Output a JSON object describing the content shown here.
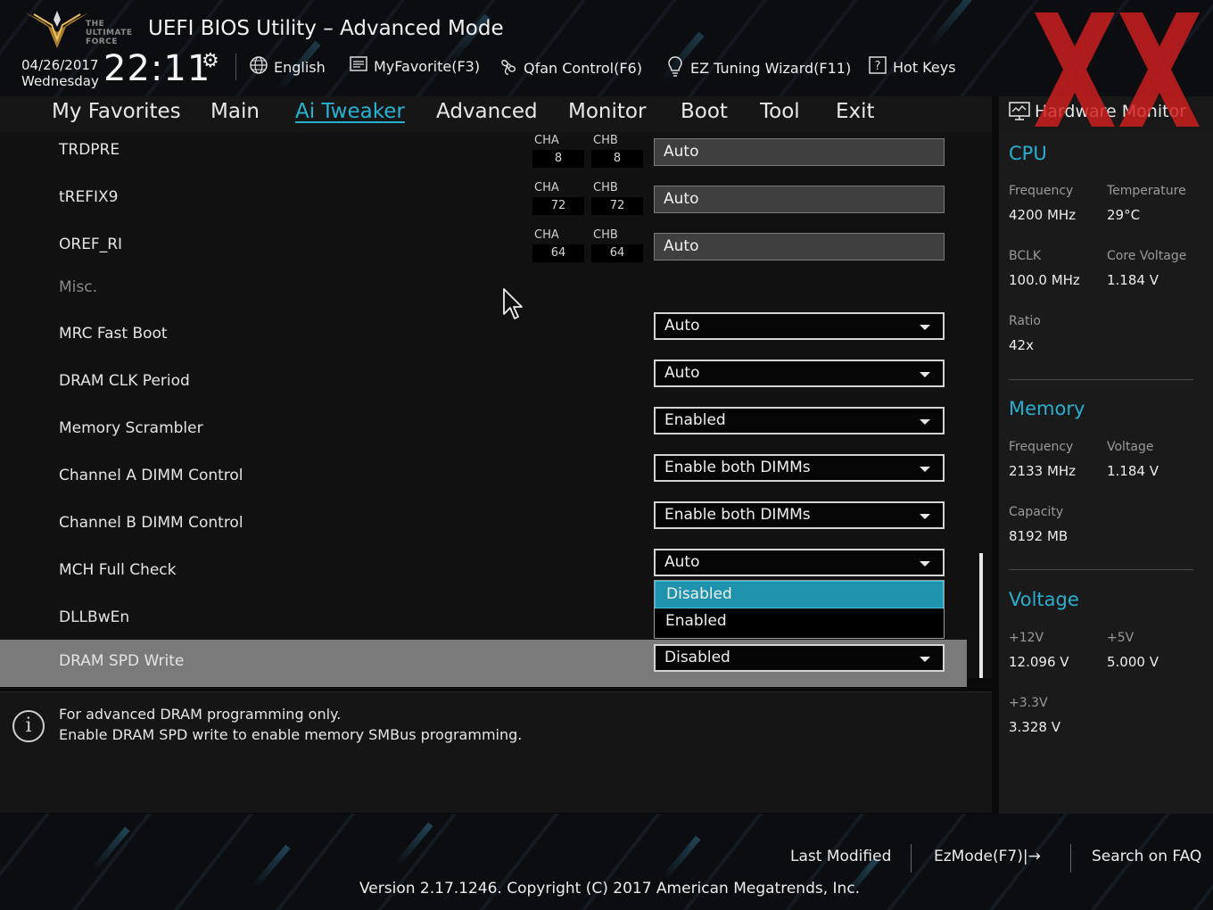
{
  "header": {
    "logo_lines": [
      "THE",
      "ULTIMATE",
      "FORCE"
    ],
    "title": "UEFI BIOS Utility – Advanced Mode",
    "date": "04/26/2017",
    "weekday": "Wednesday",
    "time": "22:11",
    "tools": [
      {
        "label": "English",
        "icon": "globe-icon"
      },
      {
        "label": "MyFavorite(F3)",
        "icon": "favorite-list-icon"
      },
      {
        "label": "Qfan Control(F6)",
        "icon": "fan-icon"
      },
      {
        "label": "EZ Tuning Wizard(F11)",
        "icon": "lightbulb-icon"
      },
      {
        "label": "Hot Keys",
        "icon": "help-box-icon"
      }
    ]
  },
  "nav": {
    "tabs": [
      {
        "label": "My Favorites",
        "active": false
      },
      {
        "label": "Main",
        "active": false
      },
      {
        "label": "Ai Tweaker",
        "active": true
      },
      {
        "label": "Advanced",
        "active": false
      },
      {
        "label": "Monitor",
        "active": false
      },
      {
        "label": "Boot",
        "active": false
      },
      {
        "label": "Tool",
        "active": false
      },
      {
        "label": "Exit",
        "active": false
      }
    ]
  },
  "settings": {
    "channel_rows": [
      {
        "label": "TRDPRE",
        "cha_label": "CHA",
        "cha": "8",
        "chb_label": "CHB",
        "chb": "8",
        "value": "Auto"
      },
      {
        "label": "tREFIX9",
        "cha_label": "CHA",
        "cha": "72",
        "chb_label": "CHB",
        "chb": "72",
        "value": "Auto"
      },
      {
        "label": "OREF_RI",
        "cha_label": "CHA",
        "cha": "64",
        "chb_label": "CHB",
        "chb": "64",
        "value": "Auto"
      }
    ],
    "misc_label": "Misc.",
    "select_rows": [
      {
        "label": "MRC Fast Boot",
        "value": "Auto"
      },
      {
        "label": "DRAM CLK Period",
        "value": "Auto"
      },
      {
        "label": "Memory Scrambler",
        "value": "Enabled"
      },
      {
        "label": "Channel A DIMM Control",
        "value": "Enable both DIMMs"
      },
      {
        "label": "Channel B DIMM Control",
        "value": "Enable both DIMMs"
      },
      {
        "label": "MCH Full Check",
        "value": "Auto"
      },
      {
        "label": "DLLBwEn",
        "value": ""
      },
      {
        "label": "DRAM SPD Write",
        "value": "Disabled"
      }
    ],
    "dropdown_options": [
      "Disabled",
      "Enabled"
    ],
    "dropdown_highlighted": "Disabled"
  },
  "help": {
    "line1": "For advanced DRAM programming only.",
    "line2": "Enable DRAM SPD write to enable memory SMBus programming."
  },
  "hw_monitor": {
    "title": "Hardware Monitor",
    "cpu": {
      "title": "CPU",
      "frequency_label": "Frequency",
      "frequency": "4200 MHz",
      "temperature_label": "Temperature",
      "temperature": "29°C",
      "bclk_label": "BCLK",
      "bclk": "100.0 MHz",
      "core_voltage_label": "Core Voltage",
      "core_voltage": "1.184 V",
      "ratio_label": "Ratio",
      "ratio": "42x"
    },
    "memory": {
      "title": "Memory",
      "frequency_label": "Frequency",
      "frequency": "2133 MHz",
      "voltage_label": "Voltage",
      "voltage": "1.184 V",
      "capacity_label": "Capacity",
      "capacity": "8192 MB"
    },
    "voltage": {
      "title": "Voltage",
      "v12_label": "+12V",
      "v12": "12.096 V",
      "v5_label": "+5V",
      "v5": "5.000 V",
      "v33_label": "+3.3V",
      "v33": "3.328 V"
    }
  },
  "footer": {
    "last_modified": "Last Modified",
    "ezmode": "EzMode(F7)|→",
    "search_faq": "Search on FAQ",
    "version": "Version 2.17.1246. Copyright (C) 2017 American Megatrends, Inc."
  },
  "colors": {
    "accent": "#27b3d0",
    "highlight": "#1f93ad",
    "watermark": "#d21f1f"
  }
}
